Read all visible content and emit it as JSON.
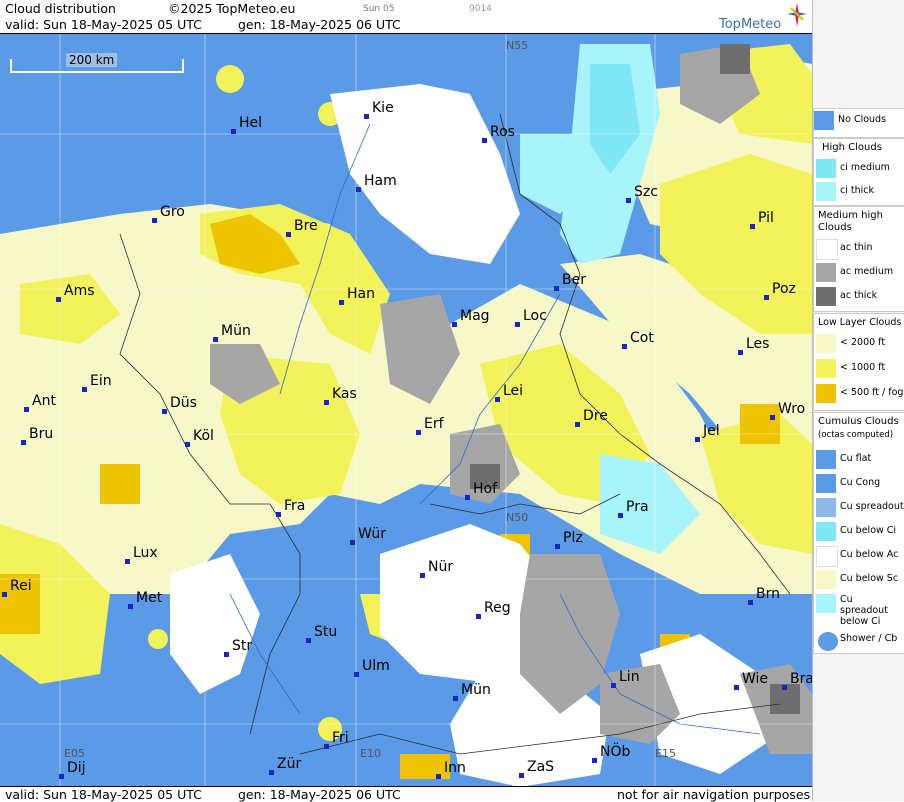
{
  "header": {
    "title": "Cloud distribution",
    "copyright": "©2025 TopMeteo.eu",
    "mini_label1": "Sun 05",
    "mini_label2": "9014",
    "valid": "valid:  Sun  18-May-2025  05 UTC",
    "gen": "gen: 18-May-2025 06 UTC",
    "logo": "TopMeteo"
  },
  "footer": {
    "valid": "valid:  Sun  18-May-2025  05 UTC",
    "gen": "gen: 18-May-2025 06 UTC",
    "notice": "not for air navigation purposes"
  },
  "scale": "200 km",
  "coords": {
    "n55": "N55",
    "n50": "N50",
    "e05": "E05",
    "e10": "E10",
    "e15": "E15"
  },
  "cities": [
    {
      "label": "Kie"
    },
    {
      "label": "Hel"
    },
    {
      "label": "Ros"
    },
    {
      "label": "Ham"
    },
    {
      "label": "Szc"
    },
    {
      "label": "Gro"
    },
    {
      "label": "Bre"
    },
    {
      "label": "Pil"
    },
    {
      "label": "Ber"
    },
    {
      "label": "Ams"
    },
    {
      "label": "Han"
    },
    {
      "label": "Poz"
    },
    {
      "label": "Mag"
    },
    {
      "label": "Loc"
    },
    {
      "label": "Mün"
    },
    {
      "label": "Cot"
    },
    {
      "label": "Les"
    },
    {
      "label": "Ein"
    },
    {
      "label": "Lei"
    },
    {
      "label": "Kas"
    },
    {
      "label": "Ant"
    },
    {
      "label": "Düs"
    },
    {
      "label": "Dre"
    },
    {
      "label": "Wro"
    },
    {
      "label": "Erf"
    },
    {
      "label": "Bru"
    },
    {
      "label": "Köl"
    },
    {
      "label": "Jel"
    },
    {
      "label": "Hof"
    },
    {
      "label": "Fra"
    },
    {
      "label": "Pra"
    },
    {
      "label": "Wür"
    },
    {
      "label": "Lux"
    },
    {
      "label": "Plz"
    },
    {
      "label": "Nür"
    },
    {
      "label": "Rei"
    },
    {
      "label": "Met"
    },
    {
      "label": "Reg"
    },
    {
      "label": "Brn"
    },
    {
      "label": "Stu"
    },
    {
      "label": "Str"
    },
    {
      "label": "Ulm"
    },
    {
      "label": "Lin"
    },
    {
      "label": "Mün"
    },
    {
      "label": "Wie"
    },
    {
      "label": "Bra"
    },
    {
      "label": "Fri"
    },
    {
      "label": "Dij"
    },
    {
      "label": "Zür"
    },
    {
      "label": "Inn"
    },
    {
      "label": "ZaS"
    },
    {
      "label": "NÖb"
    }
  ],
  "legend": {
    "no_clouds": "No Clouds",
    "high_head": "High Clouds",
    "ci_medium": "ci medium",
    "ci_thick": "ci thick",
    "medium_head": "Medium high Clouds",
    "ac_thin": "ac thin",
    "ac_medium": "ac medium",
    "ac_thick": "ac thick",
    "low_head": "Low Layer Clouds",
    "low_2000": "< 2000 ft",
    "low_1000": "< 1000 ft",
    "low_500": "< 500 ft / fog",
    "cu_head": "Cumulus Clouds",
    "cu_sub": "(octas computed)",
    "cu_flat": "Cu flat",
    "cu_cong": "Cu Cong",
    "cu_spread": "Cu spreadout",
    "cu_below_ci": "Cu below Ci",
    "cu_below_ac": "Cu below Ac",
    "cu_below_sc": "Cu below Sc",
    "cu_spread_below_ci": "Cu spreadout below Ci",
    "shower": "Shower / Cb"
  },
  "colors": {
    "no_clouds": "#5b9ae6",
    "ci_medium": "#7fe8f4",
    "ci_thick": "#a8f4fb",
    "ac_thin": "#ffffff",
    "ac_medium": "#a6a6a6",
    "ac_thick": "#6e6e6e",
    "low_2000": "#f6f8c8",
    "low_1000": "#f2f25a",
    "low_500": "#eec400"
  }
}
